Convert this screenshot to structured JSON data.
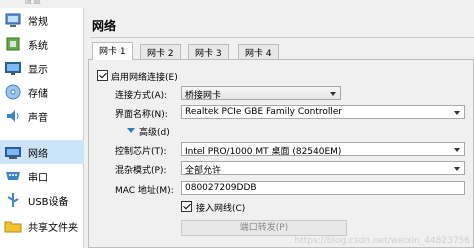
{
  "window": {
    "title": "设置"
  },
  "sidebar": {
    "items": [
      {
        "label": "常规",
        "icon": "general-icon"
      },
      {
        "label": "系统",
        "icon": "system-icon"
      },
      {
        "label": "显示",
        "icon": "display-icon"
      },
      {
        "label": "存储",
        "icon": "storage-icon"
      },
      {
        "label": "声音",
        "icon": "audio-icon"
      },
      {
        "label": "网络",
        "icon": "network-icon",
        "selected": true
      },
      {
        "label": "串口",
        "icon": "serial-port-icon"
      },
      {
        "label": "USB设备",
        "icon": "usb-icon"
      },
      {
        "label": "共享文件夹",
        "icon": "shared-folder-icon"
      }
    ]
  },
  "page": {
    "title": "网络"
  },
  "tabs": [
    "网卡 1",
    "网卡 2",
    "网卡 3",
    "网卡 4"
  ],
  "form": {
    "enable_label": "启用网络连接(E)",
    "enable_checked": true,
    "attached_label": "连接方式(A):",
    "attached_value": "桥接网卡",
    "name_label": "界面名称(N):",
    "name_value": "Realtek PCIe GBE Family Controller",
    "advanced_label": "高级(d)",
    "adapter_label": "控制芯片(T):",
    "adapter_value": "Intel PRO/1000 MT 桌面 (82540EM)",
    "promisc_label": "混杂模式(P):",
    "promisc_value": "全部允许",
    "mac_label": "MAC 地址(M):",
    "mac_value": "080027209DDB",
    "cable_label": "接入网线(C)",
    "cable_checked": true,
    "port_forward_label": "端口转发(P)"
  },
  "watermark": "https://blog.csdn.net/weixin_44823756"
}
